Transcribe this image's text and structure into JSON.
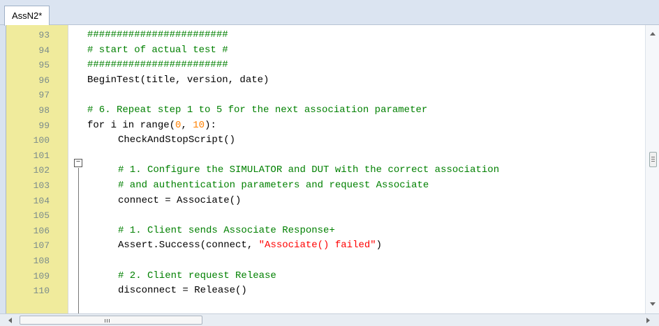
{
  "tab": {
    "label": "AssN2*"
  },
  "colors": {
    "gutter": "#f0eb9c",
    "comment": "#008000",
    "number": "#ff8000",
    "string": "#ff0000",
    "line_number": "#7a8b8b"
  },
  "icons": {
    "fold": "minus-box-icon"
  },
  "editor": {
    "lines": [
      {
        "num": "93",
        "segs": [
          {
            "t": "########################",
            "c": "comment"
          }
        ]
      },
      {
        "num": "94",
        "segs": [
          {
            "t": "# start of actual test #",
            "c": "comment"
          }
        ]
      },
      {
        "num": "95",
        "segs": [
          {
            "t": "########################",
            "c": "comment"
          }
        ]
      },
      {
        "num": "96",
        "segs": [
          {
            "t": "BeginTest(title, version, date)",
            "c": "plain"
          }
        ]
      },
      {
        "num": "97",
        "segs": []
      },
      {
        "num": "98",
        "segs": [
          {
            "t": "# 6. Repeat step 1 to 5 for the next association parameter",
            "c": "comment"
          }
        ]
      },
      {
        "num": "99",
        "segs": [
          {
            "t": "for i in range(",
            "c": "plain"
          },
          {
            "t": "0",
            "c": "num"
          },
          {
            "t": ", ",
            "c": "plain"
          },
          {
            "t": "10",
            "c": "num"
          },
          {
            "t": "):",
            "c": "plain"
          }
        ]
      },
      {
        "num": "100",
        "indent": true,
        "segs": [
          {
            "t": "CheckAndStopScript()",
            "c": "plain"
          }
        ]
      },
      {
        "num": "101",
        "indent": true,
        "segs": []
      },
      {
        "num": "102",
        "indent": true,
        "segs": [
          {
            "t": "# 1. Configure the SIMULATOR and DUT with the correct association",
            "c": "comment"
          }
        ]
      },
      {
        "num": "103",
        "indent": true,
        "segs": [
          {
            "t": "# and authentication parameters and request Associate",
            "c": "comment"
          }
        ]
      },
      {
        "num": "104",
        "indent": true,
        "segs": [
          {
            "t": "connect = Associate()",
            "c": "plain"
          }
        ]
      },
      {
        "num": "105",
        "indent": true,
        "segs": []
      },
      {
        "num": "106",
        "indent": true,
        "segs": [
          {
            "t": "# 1. Client sends Associate Response+",
            "c": "comment"
          }
        ]
      },
      {
        "num": "107",
        "indent": true,
        "segs": [
          {
            "t": "Assert.Success(connect, ",
            "c": "plain"
          },
          {
            "t": "\"Associate() failed\"",
            "c": "str"
          },
          {
            "t": ")",
            "c": "plain"
          }
        ]
      },
      {
        "num": "108",
        "indent": true,
        "segs": []
      },
      {
        "num": "109",
        "indent": true,
        "segs": [
          {
            "t": "# 2. Client request Release",
            "c": "comment"
          }
        ]
      },
      {
        "num": "110",
        "indent": true,
        "segs": [
          {
            "t": "disconnect = Release()",
            "c": "plain"
          }
        ]
      }
    ]
  }
}
